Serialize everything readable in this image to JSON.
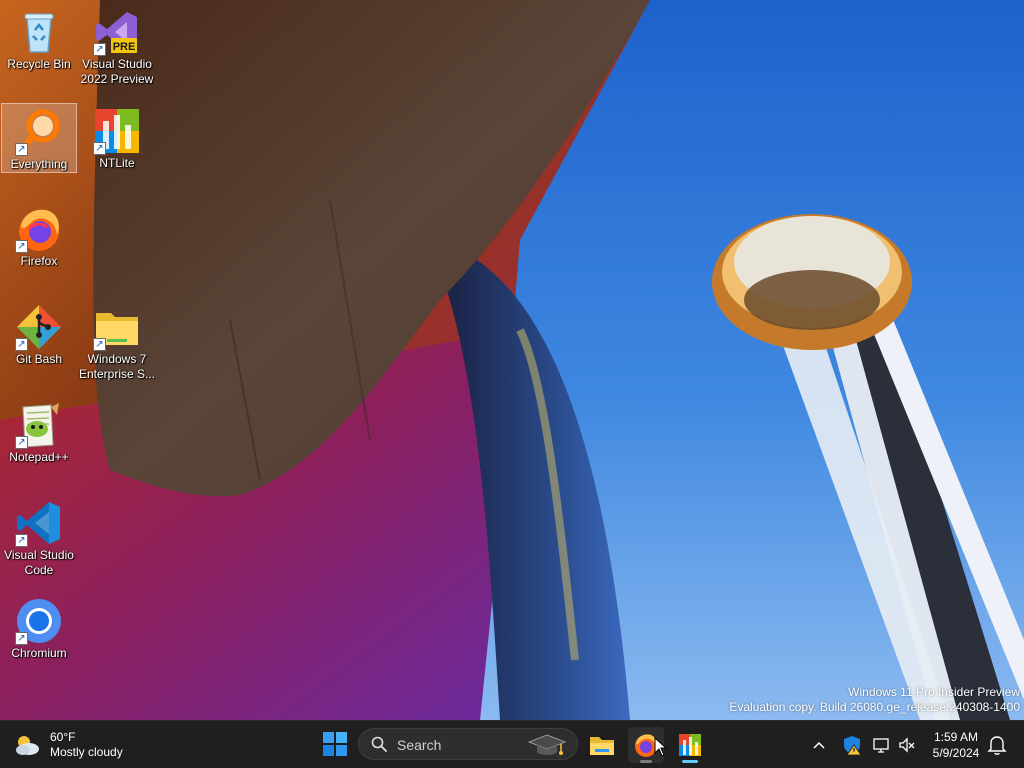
{
  "desktop": {
    "icons": [
      {
        "label": "Recycle Bin",
        "icon": "recycle-bin-icon"
      },
      {
        "label": "Visual Studio 2022 Preview",
        "line1": "Visual Studio",
        "line2": "2022 Preview",
        "badge": "PRE",
        "icon": "visual-studio-icon"
      },
      {
        "label": "Everything",
        "icon": "everything-search-icon",
        "selected": true
      },
      {
        "label": "NTLite",
        "icon": "ntlite-icon"
      },
      {
        "label": "Firefox",
        "icon": "firefox-icon"
      },
      {
        "label": "Git Bash",
        "icon": "git-bash-icon"
      },
      {
        "label": "Windows 7 Enterprise S...",
        "line1": "Windows 7",
        "line2": "Enterprise S...",
        "icon": "folder-icon"
      },
      {
        "label": "Notepad++",
        "icon": "notepad-plus-plus-icon"
      },
      {
        "label": "Visual Studio Code",
        "line1": "Visual Studio",
        "line2": "Code",
        "icon": "vscode-icon"
      },
      {
        "label": "Chromium",
        "icon": "chromium-icon"
      }
    ],
    "shortcut_arrow": "↗"
  },
  "watermark": {
    "line1": "Windows 11 Pro Insider Preview",
    "line2": "Evaluation copy. Build 26080.ge_release.240308-1400"
  },
  "taskbar": {
    "weather": {
      "temp": "60°F",
      "condition": "Mostly cloudy",
      "icon": "cloudy-weather-icon"
    },
    "search": {
      "placeholder": "Search"
    },
    "apps": [
      {
        "name": "File Explorer",
        "icon": "file-explorer-icon"
      },
      {
        "name": "Firefox",
        "icon": "firefox-icon",
        "active": true
      },
      {
        "name": "NTLite",
        "icon": "ntlite-icon",
        "running": true
      }
    ],
    "tray": {
      "chevron": "^",
      "time": "1:59 AM",
      "date": "5/9/2024"
    }
  },
  "colors": {
    "taskbar_bg": "#1f1f1f",
    "accent_blue": "#0078d4",
    "sky_blue": "#2a6ed0"
  }
}
